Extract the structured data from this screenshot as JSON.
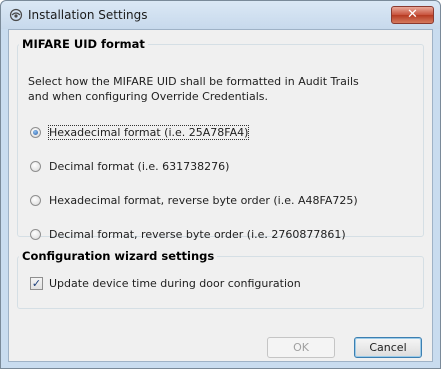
{
  "window": {
    "title": "Installation Settings",
    "icon": "settings-app-icon",
    "close_label": "✕"
  },
  "mifare_group": {
    "title": "MIFARE UID format",
    "description_line1": "Select how the MIFARE UID shall be formatted in Audit Trails",
    "description_line2": "and when configuring Override Credentials.",
    "options": [
      {
        "label": "Hexadecimal format (i.e. 25A78FA4)",
        "selected": true
      },
      {
        "label": "Decimal format (i.e. 631738276)",
        "selected": false
      },
      {
        "label": "Hexadecimal format, reverse byte order (i.e. A48FA725)",
        "selected": false
      },
      {
        "label": "Decimal format, reverse byte order (i.e. 2760877861)",
        "selected": false
      }
    ]
  },
  "wizard_group": {
    "title": "Configuration wizard settings",
    "checkbox_label": "Update device time during door configuration",
    "checkbox_checked": true,
    "check_mark": "✓"
  },
  "buttons": {
    "ok_label": "OK",
    "ok_enabled": false,
    "cancel_label": "Cancel"
  },
  "colors": {
    "window_frame": "#c9dcef",
    "client_bg": "#f0f0f0",
    "close_button": "#c8523c",
    "radio_selected": "#2a5fa8"
  }
}
